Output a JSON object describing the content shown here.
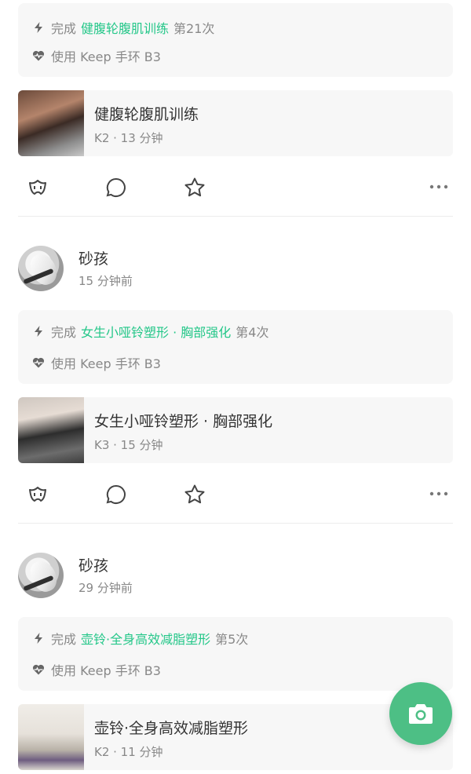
{
  "posts": [
    {
      "completion_prefix": "完成",
      "workout_name": "健腹轮腹肌训练",
      "completion_count": "第21次",
      "device_text": "使用 Keep 手环 B3",
      "workout_title": "健腹轮腹肌训练",
      "workout_meta": "K2 · 13 分钟"
    },
    {
      "username": "砂孩",
      "time": "15 分钟前",
      "completion_prefix": "完成",
      "workout_name": "女生小哑铃塑形 · 胸部强化",
      "completion_count": "第4次",
      "device_text": "使用 Keep 手环 B3",
      "workout_title": "女生小哑铃塑形 · 胸部强化",
      "workout_meta": "K3 · 15 分钟"
    },
    {
      "username": "砂孩",
      "time": "29 分钟前",
      "completion_prefix": "完成",
      "workout_name": "壶铃·全身高效减脂塑形",
      "completion_count": "第5次",
      "device_text": "使用 Keep 手环 B3",
      "workout_title": "壶铃·全身高效减脂塑形",
      "workout_meta": "K2 · 11 分钟"
    }
  ],
  "icons": {
    "lightning": "lightning-icon",
    "heart_rate": "heart-rate-icon",
    "cheer": "cheer-icon",
    "comment": "comment-icon",
    "favorite": "star-icon",
    "more": "more-icon",
    "camera": "camera-icon"
  },
  "colors": {
    "accent_green": "#24c789",
    "fab_green": "#4dbf85",
    "card_bg": "#f7f7f7",
    "secondary_text": "#888888"
  }
}
